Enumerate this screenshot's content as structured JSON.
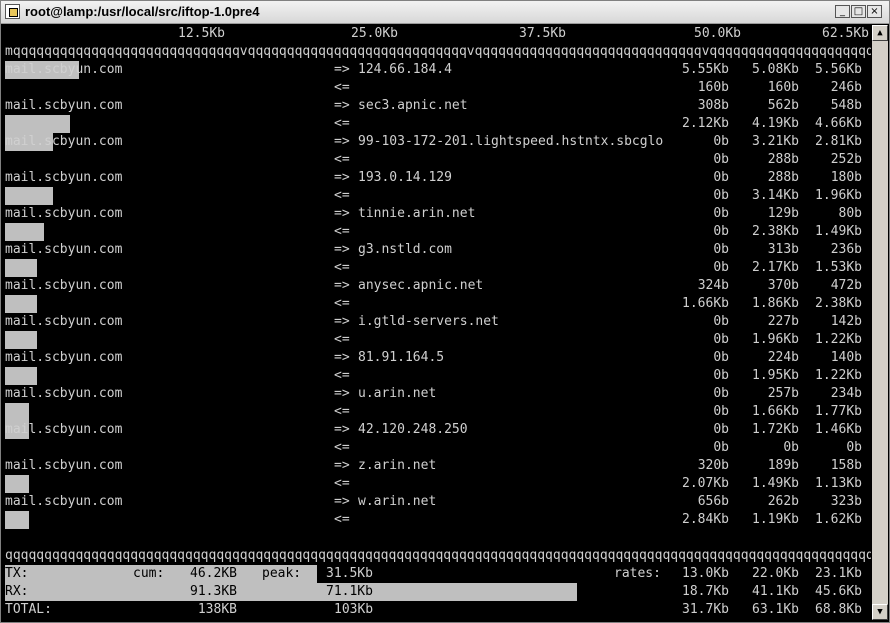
{
  "window": {
    "title": "root@lamp:/usr/local/src/iftop-1.0pre4",
    "buttons": {
      "minimize": "_",
      "maximize": "□",
      "close": "×"
    }
  },
  "scale": {
    "labels": [
      "12.5Kb",
      "25.0Kb",
      "37.5Kb",
      "50.0Kb",
      "62.5Kb"
    ],
    "ruler": "mqqqqqqqqqqqqqqqqqqqqqqqqqqqqqvqqqqqqqqqqqqqqqqqqqqqqqqqqqqvqqqqqqqqqqqqqqqqqqqqqqqqqqqqqvqqqqqqqqqqqqqqqqqqqqqqqqqqqqqvqqqqqqqqqqqqqqqqqqqqqqqqqqqqqq"
  },
  "connections": [
    {
      "host": "mail.scbyun.com",
      "out_arrow": "=>",
      "peer": "124.66.184.4",
      "in_arrow": "<=",
      "tx": [
        "5.55Kb",
        "5.08Kb",
        "5.56Kb"
      ],
      "rx": [
        "160b",
        "160b",
        "246b"
      ],
      "tx_level": 0.085,
      "rx_level": 0
    },
    {
      "host": "mail.scbyun.com",
      "out_arrow": "=>",
      "peer": "sec3.apnic.net",
      "in_arrow": "<=",
      "tx": [
        "308b",
        "562b",
        "548b"
      ],
      "rx": [
        "2.12Kb",
        "4.19Kb",
        "4.66Kb"
      ],
      "tx_level": 0,
      "rx_level": 0.075
    },
    {
      "host": "mail.scbyun.com",
      "out_arrow": "=>",
      "peer": "99-103-172-201.lightspeed.hstntx.sbcglo",
      "in_arrow": "<=",
      "tx": [
        "0b",
        "3.21Kb",
        "2.81Kb"
      ],
      "rx": [
        "0b",
        "288b",
        "252b"
      ],
      "tx_level": 0.055,
      "rx_level": 0
    },
    {
      "host": "mail.scbyun.com",
      "out_arrow": "=>",
      "peer": "193.0.14.129",
      "in_arrow": "<=",
      "tx": [
        "0b",
        "288b",
        "180b"
      ],
      "rx": [
        "0b",
        "3.14Kb",
        "1.96Kb"
      ],
      "tx_level": 0,
      "rx_level": 0.055
    },
    {
      "host": "mail.scbyun.com",
      "out_arrow": "=>",
      "peer": "tinnie.arin.net",
      "in_arrow": "<=",
      "tx": [
        "0b",
        "129b",
        "80b"
      ],
      "rx": [
        "0b",
        "2.38Kb",
        "1.49Kb"
      ],
      "tx_level": 0,
      "rx_level": 0.045
    },
    {
      "host": "mail.scbyun.com",
      "out_arrow": "=>",
      "peer": "g3.nstld.com",
      "in_arrow": "<=",
      "tx": [
        "0b",
        "313b",
        "236b"
      ],
      "rx": [
        "0b",
        "2.17Kb",
        "1.53Kb"
      ],
      "tx_level": 0,
      "rx_level": 0.037
    },
    {
      "host": "mail.scbyun.com",
      "out_arrow": "=>",
      "peer": "anysec.apnic.net",
      "in_arrow": "<=",
      "tx": [
        "324b",
        "370b",
        "472b"
      ],
      "rx": [
        "1.66Kb",
        "1.86Kb",
        "2.38Kb"
      ],
      "tx_level": 0,
      "rx_level": 0.037
    },
    {
      "host": "mail.scbyun.com",
      "out_arrow": "=>",
      "peer": "i.gtld-servers.net",
      "in_arrow": "<=",
      "tx": [
        "0b",
        "227b",
        "142b"
      ],
      "rx": [
        "0b",
        "1.96Kb",
        "1.22Kb"
      ],
      "tx_level": 0,
      "rx_level": 0.037
    },
    {
      "host": "mail.scbyun.com",
      "out_arrow": "=>",
      "peer": "81.91.164.5",
      "in_arrow": "<=",
      "tx": [
        "0b",
        "224b",
        "140b"
      ],
      "rx": [
        "0b",
        "1.95Kb",
        "1.22Kb"
      ],
      "tx_level": 0,
      "rx_level": 0.037
    },
    {
      "host": "mail.scbyun.com",
      "out_arrow": "=>",
      "peer": "u.arin.net",
      "in_arrow": "<=",
      "tx": [
        "0b",
        "257b",
        "234b"
      ],
      "rx": [
        "0b",
        "1.66Kb",
        "1.77Kb"
      ],
      "tx_level": 0,
      "rx_level": 0.028
    },
    {
      "host": "mail.scbyun.com",
      "out_arrow": "=>",
      "peer": "42.120.248.250",
      "in_arrow": "<=",
      "tx": [
        "0b",
        "1.72Kb",
        "1.46Kb"
      ],
      "rx": [
        "0b",
        "0b",
        "0b"
      ],
      "tx_level": 0.028,
      "rx_level": 0
    },
    {
      "host": "mail.scbyun.com",
      "out_arrow": "=>",
      "peer": "z.arin.net",
      "in_arrow": "<=",
      "tx": [
        "320b",
        "189b",
        "158b"
      ],
      "rx": [
        "2.07Kb",
        "1.49Kb",
        "1.13Kb"
      ],
      "tx_level": 0,
      "rx_level": 0.028
    },
    {
      "host": "mail.scbyun.com",
      "out_arrow": "=>",
      "peer": "w.arin.net",
      "in_arrow": "<=",
      "tx": [
        "656b",
        "262b",
        "323b"
      ],
      "rx": [
        "2.84Kb",
        "1.19Kb",
        "1.62Kb"
      ],
      "tx_level": 0,
      "rx_level": 0.028
    }
  ],
  "footer": {
    "separator": "qqqqqqqqqqqqqqqqqqqqqqqqqqqqqqqqqqqqqqqqqqqqqqqqqqqqqqqqqqqqqqqqqqqqqqqqqqqqqqqqqqqqqqqqqqqqqqqqqqqqqqqqqqqqqqqqqqqqqqqqqqqqqqqqqqqqqqqqqqqqqqq",
    "tx": {
      "label": "TX:",
      "cum_label": "cum:",
      "cum": "46.2KB",
      "peak_label": "peak:",
      "peak": "31.5Kb",
      "rates_label": "rates:",
      "rates": [
        "13.0Kb",
        "22.0Kb",
        "23.1Kb"
      ],
      "bar_level": 0.36
    },
    "rx": {
      "label": "RX:",
      "cum": "91.3KB",
      "peak": "71.1Kb",
      "rates": [
        "18.7Kb",
        "41.1Kb",
        "45.6Kb"
      ],
      "bar_level": 0.66
    },
    "total": {
      "label": "TOTAL:",
      "cum": "138KB",
      "peak": "103Kb",
      "rates": [
        "31.7Kb",
        "63.1Kb",
        "68.8Kb"
      ]
    }
  }
}
